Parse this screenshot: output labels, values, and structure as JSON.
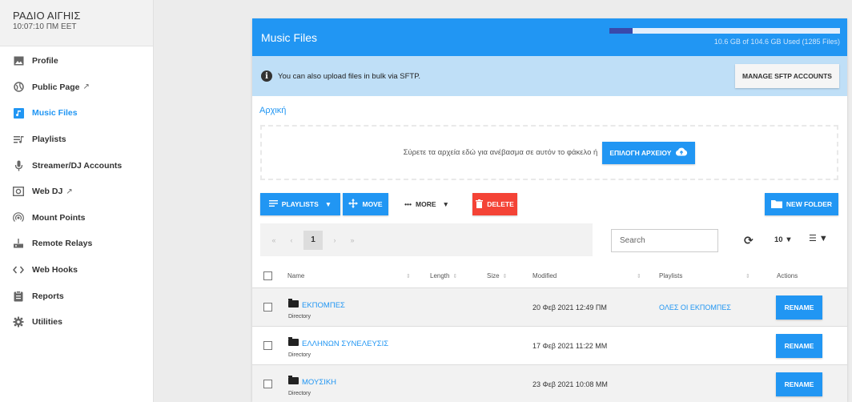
{
  "station": {
    "name": "ΡΑΔΙΟ ΑΙΓΗΙΣ",
    "time": "10:07:10 ΠΜ EET"
  },
  "sidebar": {
    "items": [
      {
        "label": "Profile",
        "icon": "image-icon",
        "external": false,
        "active": false
      },
      {
        "label": "Public Page",
        "icon": "globe-icon",
        "external": true,
        "active": false
      },
      {
        "label": "Music Files",
        "icon": "music-library-icon",
        "external": false,
        "active": true
      },
      {
        "label": "Playlists",
        "icon": "playlist-icon",
        "external": false,
        "active": false
      },
      {
        "label": "Streamer/DJ Accounts",
        "icon": "microphone-icon",
        "external": false,
        "active": false
      },
      {
        "label": "Web DJ",
        "icon": "speaker-icon",
        "external": true,
        "active": false
      },
      {
        "label": "Mount Points",
        "icon": "broadcast-icon",
        "external": false,
        "active": false
      },
      {
        "label": "Remote Relays",
        "icon": "relay-icon",
        "external": false,
        "active": false
      },
      {
        "label": "Web Hooks",
        "icon": "code-icon",
        "external": false,
        "active": false
      },
      {
        "label": "Reports",
        "icon": "clipboard-icon",
        "external": false,
        "active": false
      },
      {
        "label": "Utilities",
        "icon": "gear-icon",
        "external": false,
        "active": false
      }
    ]
  },
  "card": {
    "title": "Music Files",
    "quota": {
      "text": "10.6 GB of 104.6 GB Used (1285 Files)",
      "fraction": 0.101
    },
    "info": "You can also upload files in bulk via SFTP.",
    "sftp_button": "MANAGE SFTP ACCOUNTS",
    "breadcrumb": "Αρχική"
  },
  "dropzone": {
    "text": "Σύρετε τα αρχεία εδώ για ανέβασμα σε αυτόν το φάκελο ή",
    "button": "ΕΠΙΛΟΓΗ ΑΡΧΕΙΟΥ"
  },
  "toolbar": {
    "playlists": "PLAYLISTS",
    "move": "MOVE",
    "more": "MORE",
    "delete": "DELETE",
    "new_folder": "NEW FOLDER"
  },
  "pager": {
    "first": "«",
    "prev": "‹",
    "current": "1",
    "next": "›",
    "last": "»"
  },
  "search": {
    "placeholder": "Search"
  },
  "per_page": "10",
  "table": {
    "headers": {
      "name": "Name",
      "length": "Length",
      "size": "Size",
      "modified": "Modified",
      "playlists": "Playlists",
      "actions": "Actions"
    },
    "rows": [
      {
        "name": "ΕΚΠΟΜΠΕΣ",
        "type": "Directory",
        "modified": "20 Φεβ 2021 12:49 ΠΜ",
        "playlists": "ΟΛΕΣ ΟΙ ΕΚΠΟΜΠΕΣ",
        "action": "RENAME"
      },
      {
        "name": "ΕΛΛΗΝΩΝ ΣΥΝΕΛΕΥΣΙΣ",
        "type": "Directory",
        "modified": "17 Φεβ 2021 11:22 ΜΜ",
        "playlists": "",
        "action": "RENAME"
      },
      {
        "name": "ΜΟΥΣΙΚΗ",
        "type": "Directory",
        "modified": "23 Φεβ 2021 10:08 ΜΜ",
        "playlists": "",
        "action": "RENAME"
      }
    ]
  },
  "colors": {
    "primary": "#2196f3",
    "danger": "#f44336",
    "info_bg": "#bfdff7",
    "quota_fill": "#3949ab"
  }
}
